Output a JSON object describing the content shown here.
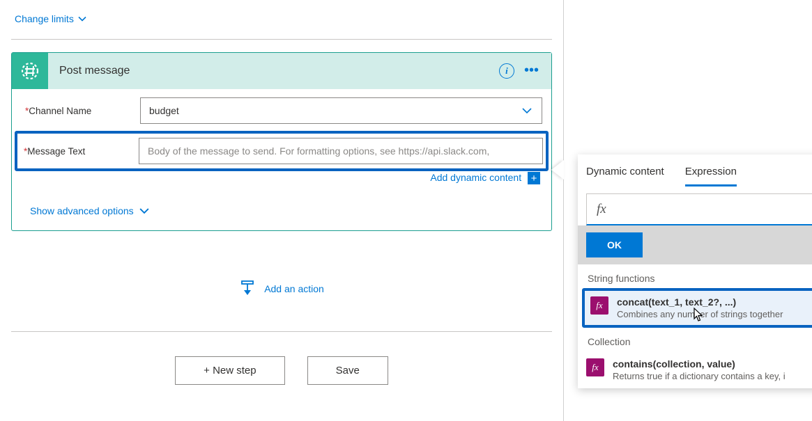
{
  "top": {
    "change_limits": "Change limits"
  },
  "card": {
    "title": "Post message",
    "channel_label": "Channel Name",
    "channel_value": "budget",
    "message_label": "Message Text",
    "message_placeholder": "Body of the message to send. For formatting options, see https://api.slack.com,",
    "add_dynamic": "Add dynamic content",
    "advanced": "Show advanced options"
  },
  "flow": {
    "add_action": "Add an action",
    "new_step": "+ New step",
    "save": "Save"
  },
  "popup": {
    "tab_dynamic": "Dynamic content",
    "tab_expression": "Expression",
    "fx_symbol": "fx",
    "ok": "OK",
    "section_string": "String functions",
    "section_collection": "Collection",
    "functions": [
      {
        "name": "concat(text_1, text_2?, ...)",
        "desc": "Combines any number of strings together"
      },
      {
        "name": "contains(collection, value)",
        "desc": "Returns true if a dictionary contains a key, i"
      }
    ]
  }
}
